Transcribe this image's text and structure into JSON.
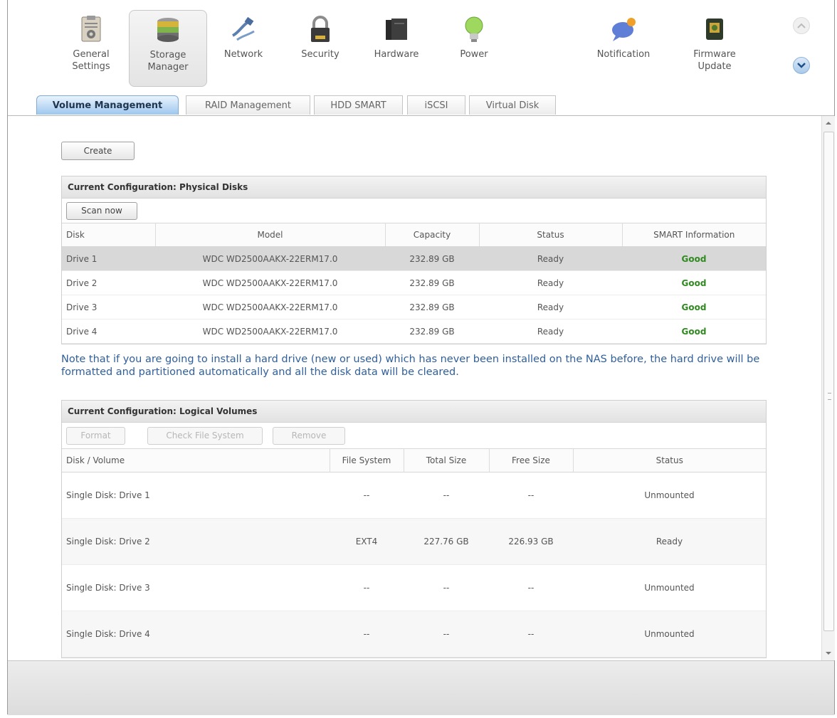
{
  "apps": [
    {
      "label": "General\nSettings",
      "icon": "clipboard-settings-icon"
    },
    {
      "label": "Storage\nManager",
      "icon": "disk-stack-icon"
    },
    {
      "label": "Network",
      "icon": "network-plug-icon"
    },
    {
      "label": "Security",
      "icon": "padlock-icon"
    },
    {
      "label": "Hardware",
      "icon": "nas-hardware-icon"
    },
    {
      "label": "Power",
      "icon": "lightbulb-icon"
    },
    {
      "label": "Notification",
      "icon": "chat-bubble-icon"
    },
    {
      "label": "Firmware\nUpdate",
      "icon": "chip-update-icon"
    }
  ],
  "tabs": [
    "Volume Management",
    "RAID Management",
    "HDD SMART",
    "iSCSI",
    "Virtual Disk"
  ],
  "create_label": "Create",
  "physical": {
    "title": "Current Configuration: Physical Disks",
    "scan_label": "Scan now",
    "headers": [
      "Disk",
      "Model",
      "Capacity",
      "Status",
      "SMART Information"
    ],
    "rows": [
      {
        "disk": "Drive 1",
        "model": "WDC WD2500AAKX-22ERM17.0",
        "capacity": "232.89 GB",
        "status": "Ready",
        "smart": "Good"
      },
      {
        "disk": "Drive 2",
        "model": "WDC WD2500AAKX-22ERM17.0",
        "capacity": "232.89 GB",
        "status": "Ready",
        "smart": "Good"
      },
      {
        "disk": "Drive 3",
        "model": "WDC WD2500AAKX-22ERM17.0",
        "capacity": "232.89 GB",
        "status": "Ready",
        "smart": "Good"
      },
      {
        "disk": "Drive 4",
        "model": "WDC WD2500AAKX-22ERM17.0",
        "capacity": "232.89 GB",
        "status": "Ready",
        "smart": "Good"
      }
    ]
  },
  "note": "Note that if you are going to install a hard drive (new or used) which has never been installed on the NAS before, the hard drive will be formatted and partitioned automatically and all the disk data will be cleared.",
  "logical": {
    "title": "Current Configuration: Logical Volumes",
    "buttons": [
      "Format",
      "Check File System",
      "Remove"
    ],
    "headers": [
      "Disk / Volume",
      "File System",
      "Total Size",
      "Free Size",
      "Status"
    ],
    "rows": [
      {
        "volume": "Single Disk: Drive 1",
        "fs": "--",
        "total": "--",
        "free": "--",
        "status": "Unmounted"
      },
      {
        "volume": "Single Disk: Drive 2",
        "fs": "EXT4",
        "total": "227.76 GB",
        "free": "226.93 GB",
        "status": "Ready"
      },
      {
        "volume": "Single Disk: Drive 3",
        "fs": "--",
        "total": "--",
        "free": "--",
        "status": "Unmounted"
      },
      {
        "volume": "Single Disk: Drive 4",
        "fs": "--",
        "total": "--",
        "free": "--",
        "status": "Unmounted"
      }
    ]
  },
  "colors": {
    "accent": "#9cc7ee",
    "note": "#2f5f9c",
    "good": "#2f8a1f"
  }
}
